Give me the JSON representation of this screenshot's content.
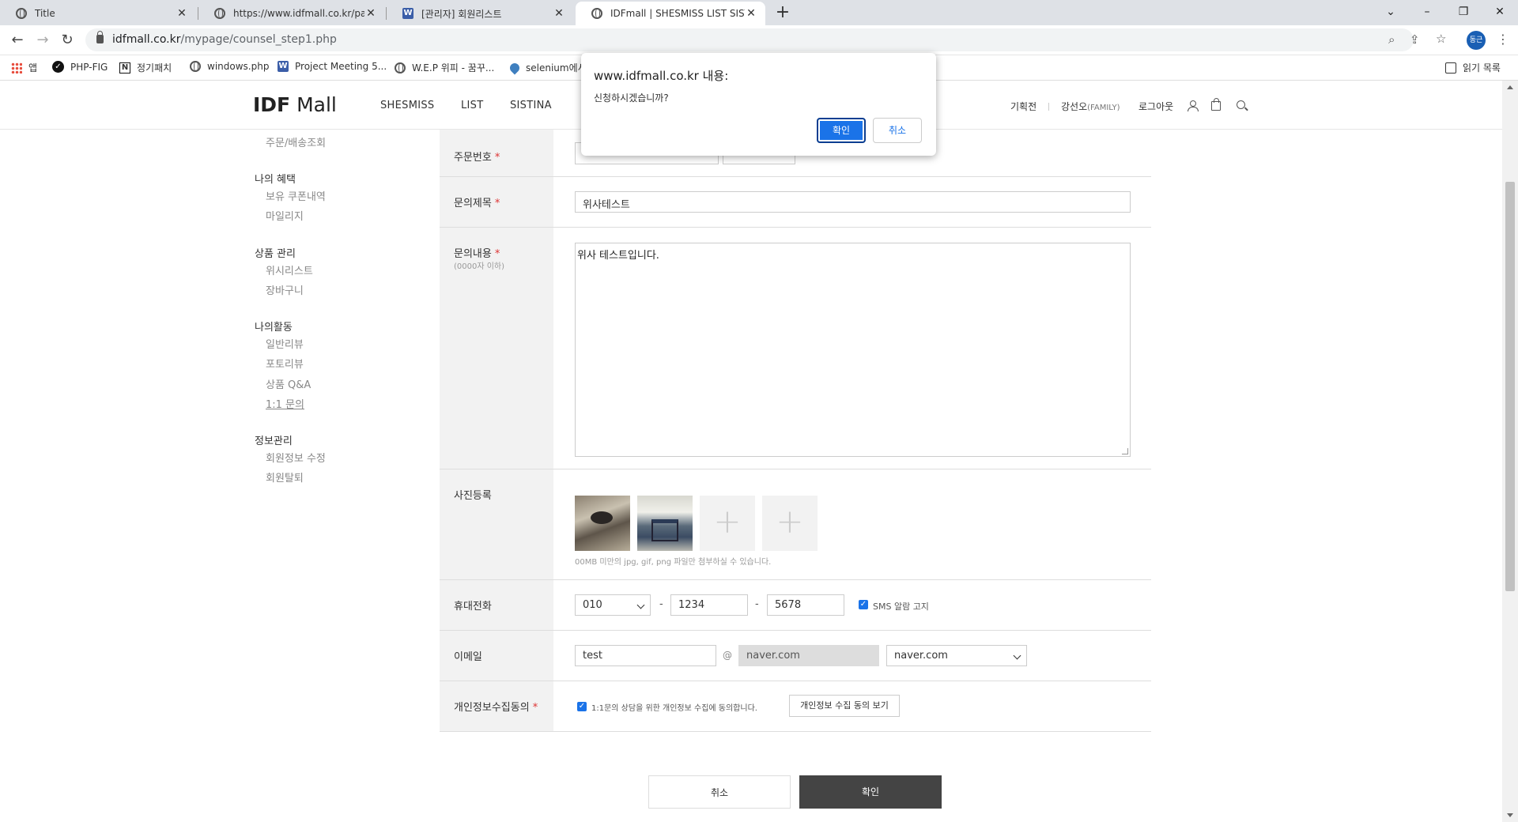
{
  "browser": {
    "tabs": [
      {
        "title": "Title"
      },
      {
        "title": "https://www.idfmall.co.kr/patch_"
      },
      {
        "title": "[관리자] 회원리스트"
      },
      {
        "title": "IDFmall | SHESMISS LIST SISTIN"
      }
    ],
    "url_host": "idfmall.co.kr",
    "url_path": "/mypage/counsel_step1.php",
    "profile_initials": "동근",
    "bookmarks": [
      "앱",
      "PHP-FIG",
      "정기패치",
      "windows.php",
      "Project Meeting 5...",
      "W.E.P 위피 - 꿈꾸...",
      "selenium에서"
    ],
    "reading_list": "읽기 목록"
  },
  "header": {
    "logo_bold": "IDF",
    "logo_light": "Mall",
    "nav": [
      "SHESMISS",
      "LIST",
      "SISTINA"
    ],
    "util": {
      "event": "기획전",
      "user_name": "강선오",
      "user_grade": "(FAMILY)",
      "logout": "로그아웃"
    }
  },
  "sidebar": {
    "top_item": "주문/배송조회",
    "groups": [
      {
        "title": "나의 혜택",
        "items": [
          "보유 쿠폰내역",
          "마일리지"
        ]
      },
      {
        "title": "상품 관리",
        "items": [
          "위시리스트",
          "장바구니"
        ]
      },
      {
        "title": "나의활동",
        "items": [
          "일반리뷰",
          "포토리뷰",
          "상품 Q&A",
          "1:1 문의"
        ]
      },
      {
        "title": "정보관리",
        "items": [
          "회원정보 수정",
          "회원탈퇴"
        ]
      }
    ]
  },
  "form": {
    "order_no_label": "주문번호",
    "subject_label": "문의제목",
    "subject_value": "위사테스트",
    "content_label": "문의내용",
    "content_note": "(0000자 이하)",
    "content_value": "위사 테스트입니다.",
    "photo_label": "사진등록",
    "photo_hint": "00MB 미만의 jpg, gif, png 파일만 첨부하실 수 있습니다.",
    "phone_label": "휴대전화",
    "phone_prefix": "010",
    "phone_mid": "1234",
    "phone_last": "5678",
    "dash": "-",
    "sms_label": "SMS 알람 고지",
    "sms_checked": true,
    "email_label": "이메일",
    "email_id": "test",
    "at": "@",
    "email_domain": "naver.com",
    "email_domain_select": "naver.com",
    "privacy_label": "개인정보수집동의",
    "privacy_text": "1:1문의 상담을 위한 개인정보 수집에 동의합니다.",
    "privacy_checked": true,
    "privacy_view_button": "개인정보 수집 동의 보기",
    "required_mark": "*"
  },
  "buttons": {
    "cancel": "취소",
    "confirm": "확인"
  },
  "dialog": {
    "title": "www.idfmall.co.kr 내용:",
    "message": "신청하시겠습니까?",
    "ok": "확인",
    "cancel": "취소"
  },
  "colors": {
    "accent": "#1a73e8",
    "dark_button": "#444444",
    "required": "#dd3333"
  }
}
